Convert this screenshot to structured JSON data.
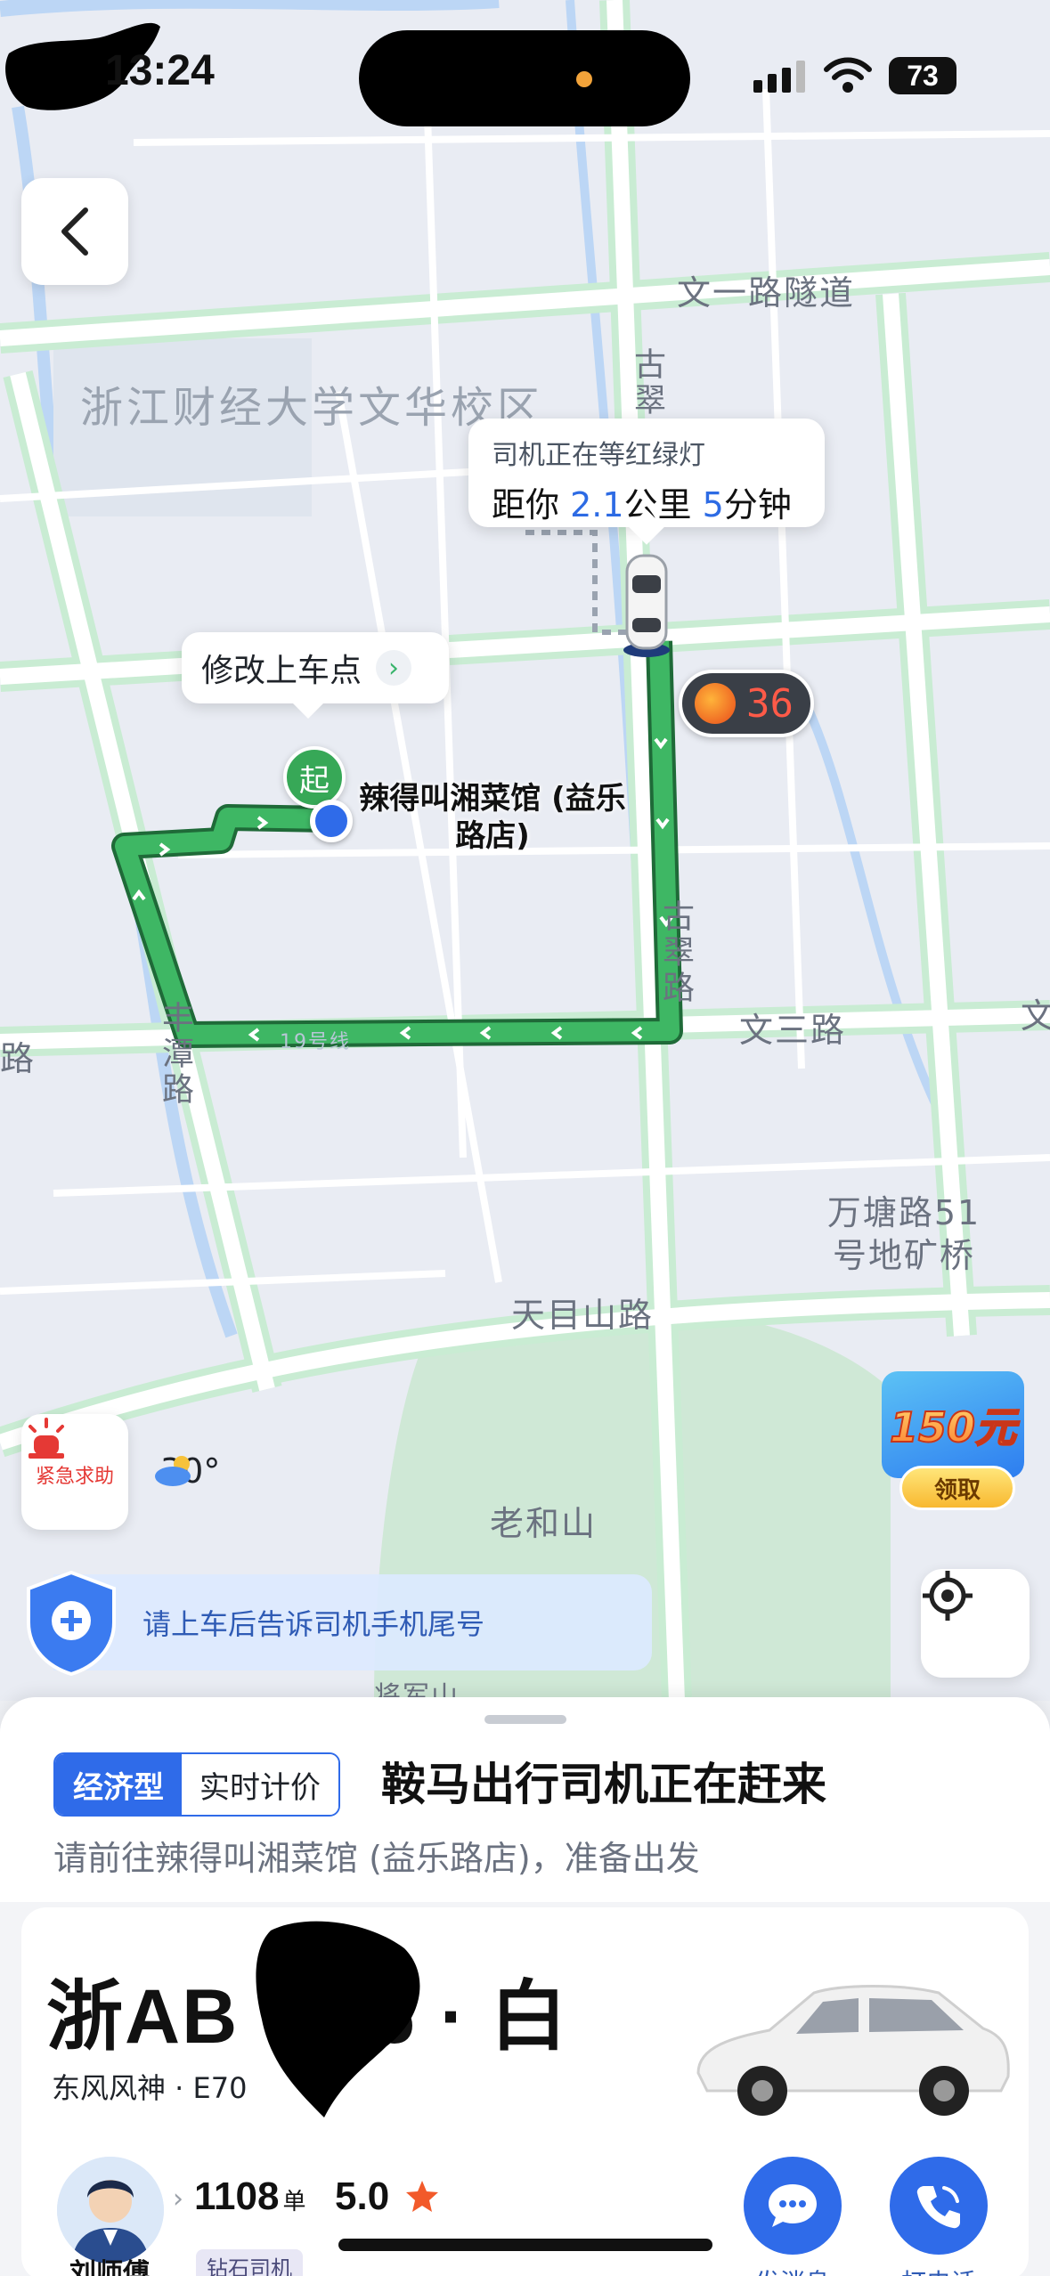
{
  "status_bar": {
    "time": "13:24",
    "battery": "73"
  },
  "map": {
    "labels": {
      "road_wenyi": "文一路隧道",
      "campus": "浙江财经大学文华校区",
      "road_gucui_top": "古翠",
      "road_gucui": "古翠路",
      "road_wensan": "文三路",
      "road_feng": "丰潭路",
      "road_lu": "路",
      "road_wen_right": "文",
      "bridge": "万塘路51号地矿桥",
      "road_tianmushan": "天目山路",
      "poi_laoheshan": "老和山",
      "poi_jiangjunshan": "将军山",
      "bus_line": "19号线"
    },
    "driver_bubble": {
      "status": "司机正在等红绿灯",
      "eta_prefix": "距你",
      "distance": "2.1",
      "distance_unit": "公里",
      "minutes": "5",
      "minutes_unit": "分钟"
    },
    "modify_pickup": "修改上车点",
    "pickup_pin": "起",
    "pickup_name": "辣得叫湘菜馆 (益乐路店)",
    "traffic_light_count": "36",
    "emergency_label": "紧急求助",
    "weather": {
      "temp": "30°"
    },
    "promo": {
      "amount": "150元",
      "claim": "领取"
    },
    "notice": "请上车后告诉司机手机尾号"
  },
  "sheet": {
    "tag_type": "经济型",
    "tag_pricing": "实时计价",
    "status": "鞍马出行司机正在赶来",
    "instruction": "请前往辣得叫湘菜馆 (益乐路店)，准备出发",
    "plate": "浙AB",
    "plate_suffix": "6 · 白",
    "car_model": "东风风神 · E70",
    "driver": {
      "name": "刘师傅",
      "orders": "1108",
      "orders_unit": "单",
      "rating": "5.0",
      "level": "钻石司机"
    },
    "actions": {
      "message": "发消息",
      "call": "打电话"
    }
  },
  "colors": {
    "accent": "#2f6be9",
    "route": "#2e9a4e",
    "emergency": "#e53935"
  }
}
